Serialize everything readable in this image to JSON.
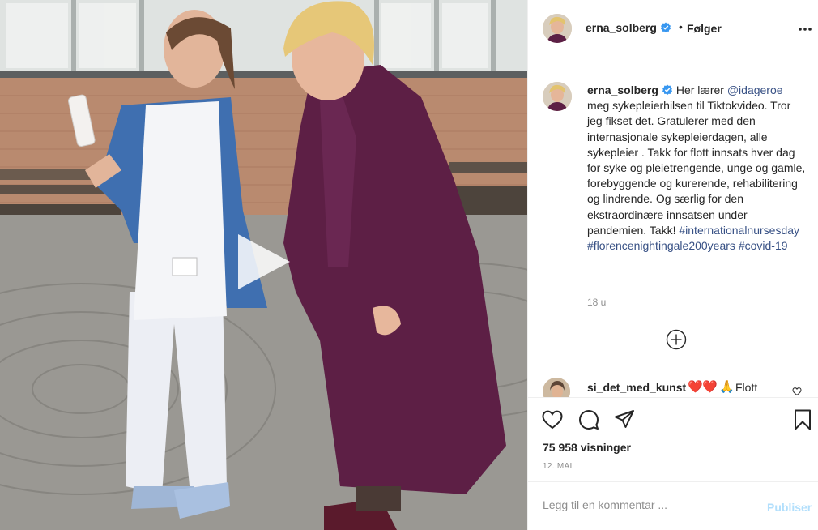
{
  "post": {
    "username": "erna_solberg",
    "follow_dot": "•",
    "follow_label": "Følger",
    "more_icon": "more-horizontal-icon",
    "verified_icon": "verified-badge-icon",
    "caption": {
      "username": "erna_solberg",
      "text_1": " Her lærer ",
      "mention": "@idageroe",
      "text_2": " meg sykepleierhilsen til Tiktokvideo. Tror jeg fikset det. Gratulerer med den internasjonale sykepleierdagen, alle sykepleier . Takk for flott innsats hver dag for syke og pleietrengende, unge og gamle, forebyggende og kurerende, rehabilitering og lindrende. Og særlig for den ekstraordinære innsatsen under pandemien. Takk! ",
      "hashtag_1": "#internationalnursesday",
      "space": " ",
      "hashtag_2": "#florencenightingale200years",
      "hashtag_3": "#covid-19"
    },
    "time_ago": "18 u",
    "load_more_icon": "plus-circle-icon",
    "comment": {
      "username": "si_det_med_kunst",
      "emoji_1": "❤️",
      "emoji_2": "❤️",
      "emoji_3": "🙏",
      "text": "Flott"
    },
    "actions": {
      "like_icon": "heart-icon",
      "comment_icon": "comment-icon",
      "share_icon": "send-icon",
      "save_icon": "bookmark-icon"
    },
    "views": "75 958 visninger",
    "date": "12. MAI",
    "comment_placeholder": "Legg til en kommentar ...",
    "publish_label": "Publiser"
  },
  "media": {
    "play_icon": "play-icon"
  },
  "colors": {
    "link": "#385185",
    "muted": "#8e8e8e",
    "publish_disabled": "#b2dffc",
    "verified": "#3897f0"
  }
}
